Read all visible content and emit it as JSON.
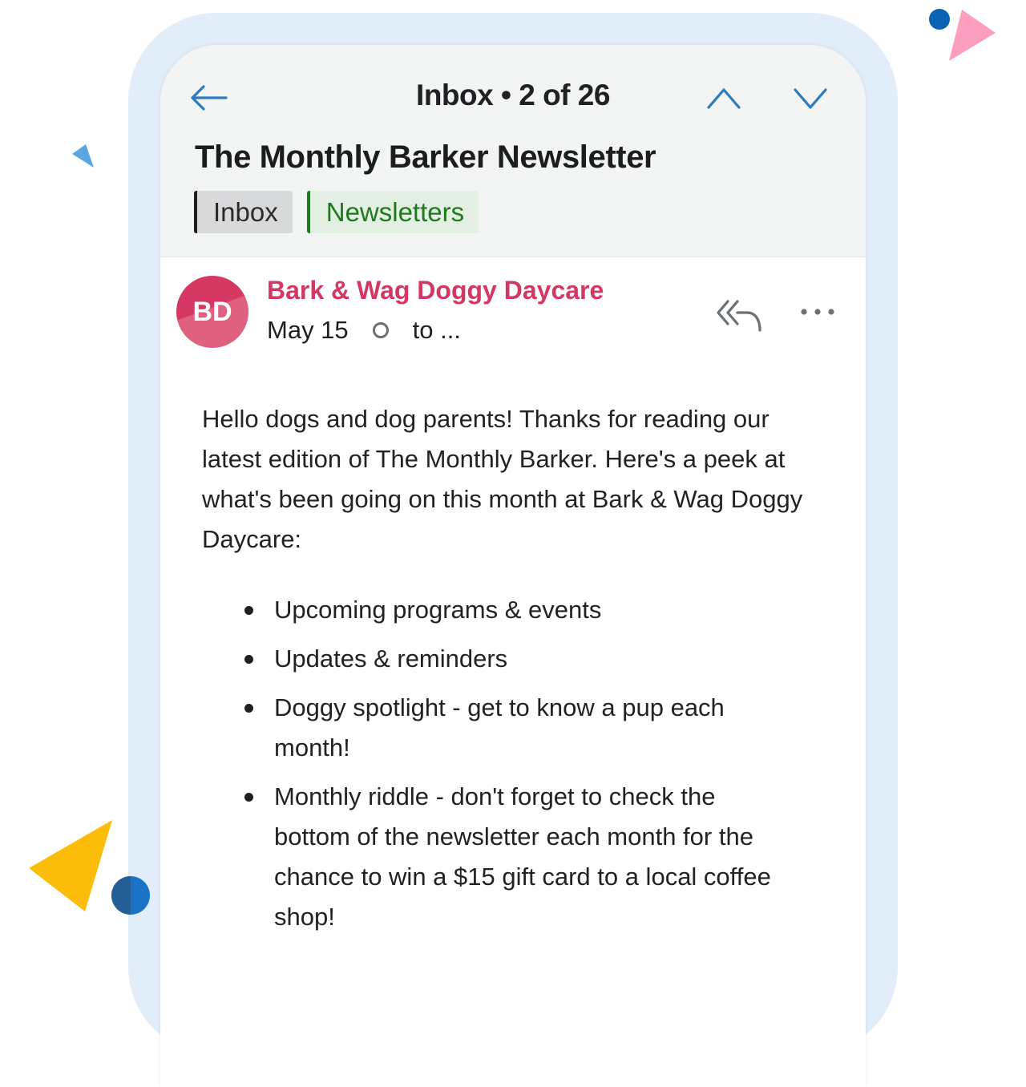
{
  "header": {
    "nav_title": "Inbox • 2 of 26",
    "back_icon": "arrow-left-icon",
    "prev_icon": "chevron-up-icon",
    "next_icon": "chevron-down-icon",
    "subject": "The Monthly Barker Newsletter",
    "labels": [
      {
        "text": "Inbox",
        "color": "#1f1f1f"
      },
      {
        "text": "Newsletters",
        "color": "#1c7a1c"
      }
    ]
  },
  "message": {
    "avatar_initials": "BD",
    "avatar_color": "#d63864",
    "sender": "Bark & Wag Doggy Daycare",
    "date": "May 15",
    "recipients": "to ...",
    "reply_all_icon": "reply-all-icon",
    "more_icon": "more-horizontal-icon"
  },
  "body": {
    "intro": "Hello dogs and dog parents! Thanks for reading our latest edition of The Monthly Barker. Here's a peek at what's been going on this month at Bark & Wag Doggy Daycare:",
    "bullets": [
      "Upcoming programs & events",
      "Updates & reminders",
      "Doggy spotlight - get to know a pup each month!",
      "Monthly riddle - don't forget to check the bottom of the newsletter each month for the chance to win a $15 gift card to a local coffee shop!"
    ]
  },
  "colors": {
    "accent_blue": "#2b7bc0",
    "frame": "#e1eef9",
    "sender_pink": "#d43763"
  }
}
